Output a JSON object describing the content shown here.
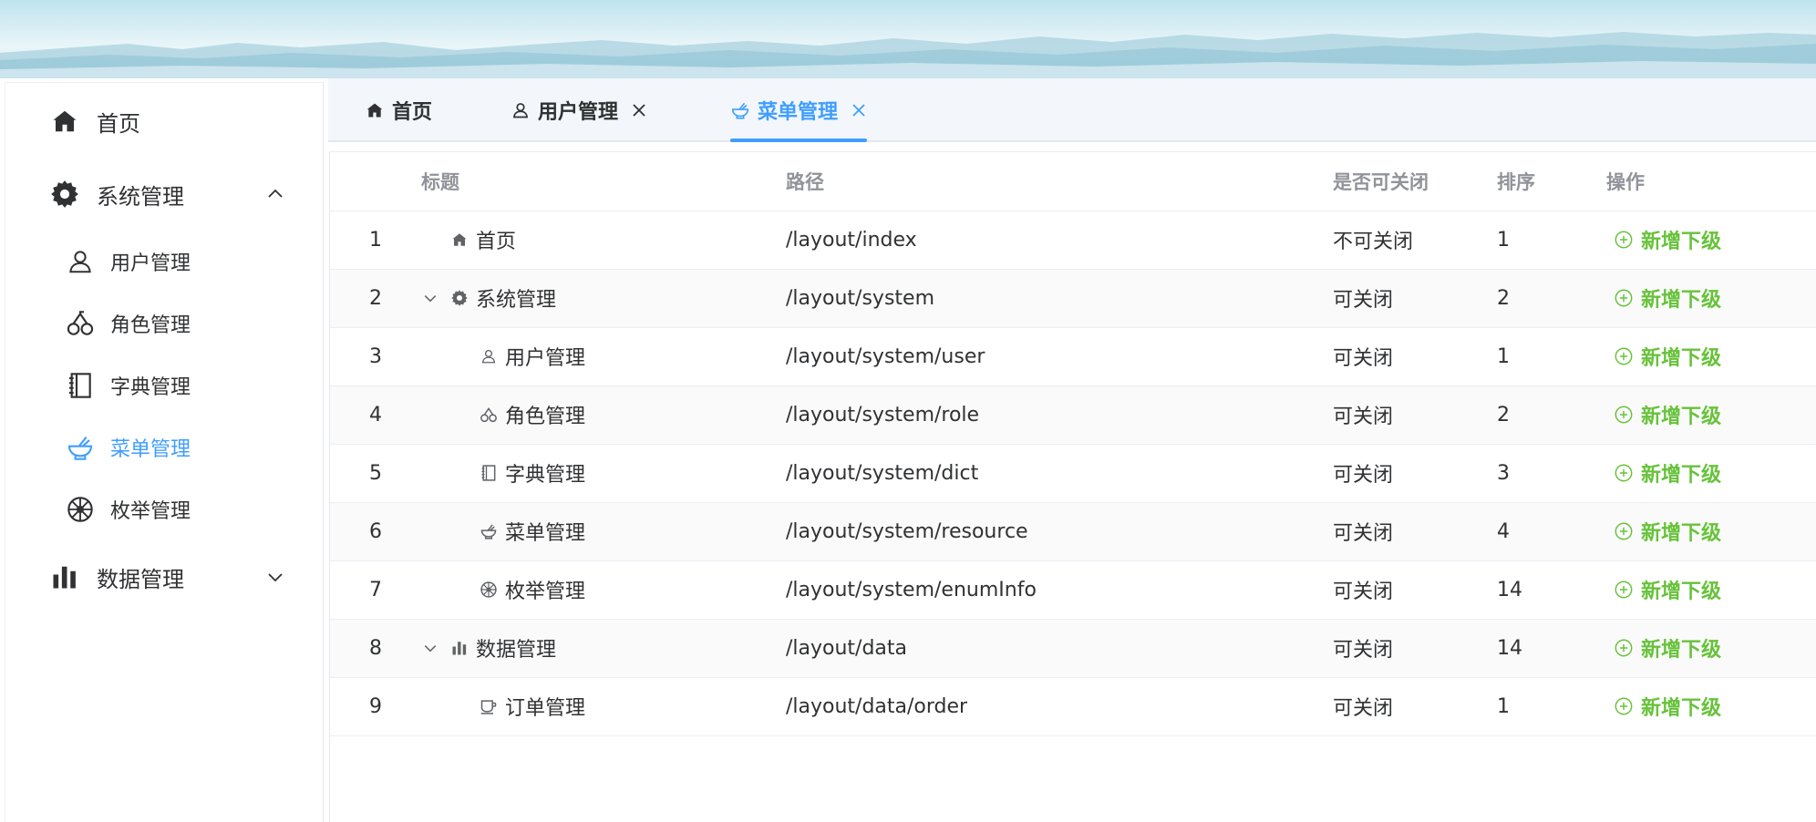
{
  "sidebar": {
    "home": {
      "label": "首页",
      "icon": "home-icon"
    },
    "system": {
      "label": "系统管理",
      "icon": "gear-icon",
      "expanded": true
    },
    "system_items": [
      {
        "label": "用户管理",
        "icon": "user-icon",
        "active": false
      },
      {
        "label": "角色管理",
        "icon": "cherry-icon",
        "active": false
      },
      {
        "label": "字典管理",
        "icon": "notebook-icon",
        "active": false
      },
      {
        "label": "菜单管理",
        "icon": "bowl-icon",
        "active": true
      },
      {
        "label": "枚举管理",
        "icon": "wheel-icon",
        "active": false
      }
    ],
    "data": {
      "label": "数据管理",
      "icon": "bar-chart-icon",
      "expanded": false
    }
  },
  "tabs": [
    {
      "label": "首页",
      "icon": "home-icon",
      "closable": false,
      "active": false
    },
    {
      "label": "用户管理",
      "icon": "user-icon",
      "closable": true,
      "active": false
    },
    {
      "label": "菜单管理",
      "icon": "bowl-icon",
      "closable": true,
      "active": true
    }
  ],
  "table": {
    "headers": {
      "title": "标题",
      "path": "路径",
      "closable": "是否可关闭",
      "sort": "排序",
      "actions": "操作"
    },
    "action_label": "新增下级",
    "rows": [
      {
        "index": "1",
        "title": "首页",
        "icon": "home-icon",
        "level": 0,
        "expander": false,
        "path": "/layout/index",
        "closable": "不可关闭",
        "sort": "1"
      },
      {
        "index": "2",
        "title": "系统管理",
        "icon": "gear-icon",
        "level": 0,
        "expander": true,
        "path": "/layout/system",
        "closable": "可关闭",
        "sort": "2"
      },
      {
        "index": "3",
        "title": "用户管理",
        "icon": "user-icon",
        "level": 1,
        "expander": false,
        "path": "/layout/system/user",
        "closable": "可关闭",
        "sort": "1"
      },
      {
        "index": "4",
        "title": "角色管理",
        "icon": "cherry-icon",
        "level": 1,
        "expander": false,
        "path": "/layout/system/role",
        "closable": "可关闭",
        "sort": "2"
      },
      {
        "index": "5",
        "title": "字典管理",
        "icon": "notebook-icon",
        "level": 1,
        "expander": false,
        "path": "/layout/system/dict",
        "closable": "可关闭",
        "sort": "3"
      },
      {
        "index": "6",
        "title": "菜单管理",
        "icon": "bowl-icon",
        "level": 1,
        "expander": false,
        "path": "/layout/system/resource",
        "closable": "可关闭",
        "sort": "4"
      },
      {
        "index": "7",
        "title": "枚举管理",
        "icon": "wheel-icon",
        "level": 1,
        "expander": false,
        "path": "/layout/system/enumInfo",
        "closable": "可关闭",
        "sort": "14"
      },
      {
        "index": "8",
        "title": "数据管理",
        "icon": "bar-chart-icon",
        "level": 0,
        "expander": true,
        "path": "/layout/data",
        "closable": "可关闭",
        "sort": "14"
      },
      {
        "index": "9",
        "title": "订单管理",
        "icon": "cup-icon",
        "level": 1,
        "expander": false,
        "path": "/layout/data/order",
        "closable": "可关闭",
        "sort": "1"
      }
    ]
  },
  "colors": {
    "accent": "#409eff",
    "success": "#67c23a",
    "text": "#303133",
    "muted": "#909399"
  }
}
